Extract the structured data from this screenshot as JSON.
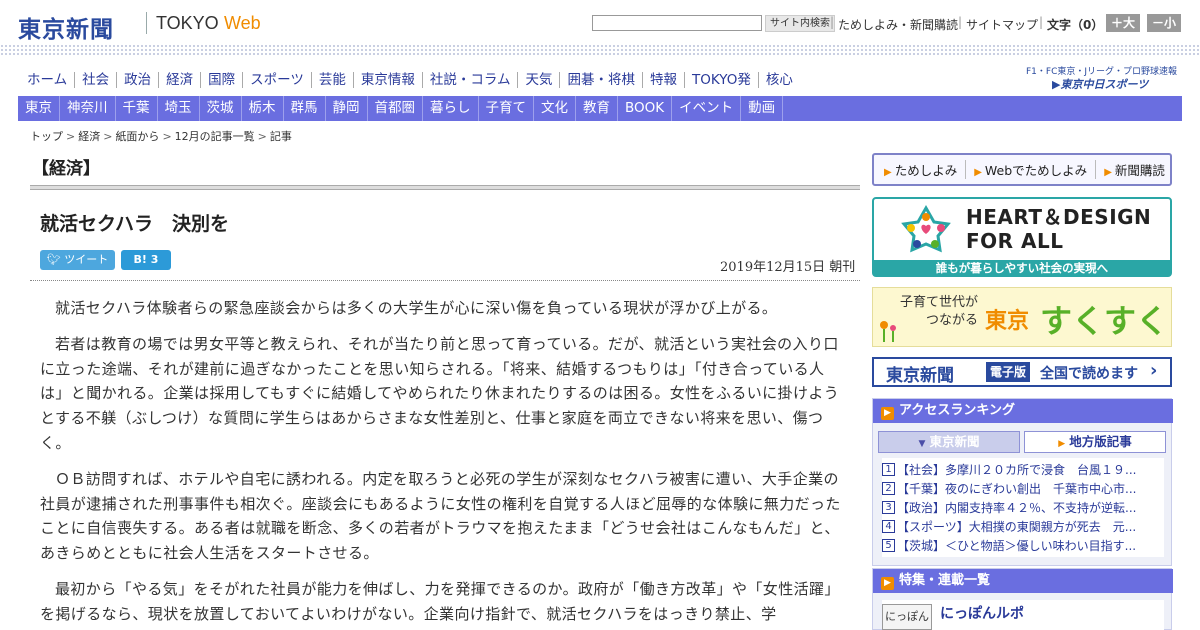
{
  "header": {
    "logo_cjk": "東京新聞",
    "logo_tokyo": "TOKYO",
    "logo_web": "Web",
    "search_button": "サイト内検索",
    "links": [
      "ためしよみ・新聞購読",
      "サイトマップ"
    ],
    "fontsize_label": "文字（0）",
    "font_bigger": "＋大",
    "font_smaller": "－小"
  },
  "main_nav": [
    "ホーム",
    "社会",
    "政治",
    "経済",
    "国際",
    "スポーツ",
    "芸能",
    "東京情報",
    "社説・コラム",
    "天気",
    "囲碁・将棋",
    "特報",
    "TOKYO発",
    "核心"
  ],
  "chunichi": {
    "top_text": "F1・FC東京・Jリーグ・プロ野球速報",
    "logo_text": "▶東京中日スポーツ"
  },
  "local_nav": [
    "東京",
    "神奈川",
    "千葉",
    "埼玉",
    "茨城",
    "栃木",
    "群馬",
    "静岡",
    "首都圏",
    "暮らし",
    "子育て",
    "文化",
    "教育",
    "BOOK",
    "イベント",
    "動画"
  ],
  "breadcrumb": [
    "トップ",
    "経済",
    "紙面から",
    "12月の記事一覧",
    "記事"
  ],
  "article": {
    "section": "【経済】",
    "headline": "就活セクハラ　決別を",
    "tweet_label": "ツイート",
    "hatena_label": "B! 3",
    "date": "2019年12月15日 朝刊",
    "paragraphs": [
      "就活セクハラ体験者らの緊急座談会からは多くの大学生が心に深い傷を負っている現状が浮かび上がる。",
      "若者は教育の場では男女平等と教えられ、それが当たり前と思って育っている。だが、就活という実社会の入り口に立った途端、それが建前に過ぎなかったことを思い知らされる。「将来、結婚するつもりは」「付き合っている人は」と聞かれる。企業は採用してもすぐに結婚してやめられたり休まれたりするのは困る。女性をふるいに掛けようとする不躾（ぶしつけ）な質問に学生らはあからさまな女性差別と、仕事と家庭を両立できない将来を思い、傷つく。",
      "ＯＢ訪問すれば、ホテルや自宅に誘われる。内定を取ろうと必死の学生が深刻なセクハラ被害に遭い、大手企業の社員が逮捕された刑事事件も相次ぐ。座談会にもあるように女性の権利を自覚する人ほど屈辱的な体験に無力だったことに自信喪失する。ある者は就職を断念、多くの若者がトラウマを抱えたまま「どうせ会社はこんなもんだ」と、あきらめとともに社会人生活をスタートさせる。",
      "最初から「やる気」をそがれた社員が能力を伸ばし、力を発揮できるのか。政府が「働き方改革」や「女性活躍」を掲げるなら、現状を放置しておいてよいわけがない。企業向け指針で、就活セクハラをはっきり禁止、学"
    ]
  },
  "sidebar": {
    "promo": [
      "ためしよみ",
      "Webでためしよみ",
      "新聞購読"
    ],
    "heart_title_1": "HEART＆DESIGN",
    "heart_title_2": "FOR ALL",
    "heart_sub": "誰もが暮らしやすい社会の実現へ",
    "sukusuku_small_1": "子育て世代が",
    "sukusuku_small_2": "つながる",
    "sukusuku_tokyo": "東京",
    "sukusuku_big": "すくすく",
    "denshi_logo": "東京新聞",
    "denshi_tag": "電子版",
    "denshi_text": "全国で読めます",
    "ranking_title": "アクセスランキング",
    "ranking_tabs": [
      "東京新聞",
      "地方版記事"
    ],
    "ranking": [
      {
        "num": "1",
        "text": "【社会】多摩川２０カ所で浸食　台風１９..."
      },
      {
        "num": "2",
        "text": "【千葉】夜のにぎわい創出　千葉市中心市..."
      },
      {
        "num": "3",
        "text": "【政治】内閣支持率４２％、不支持が逆転..."
      },
      {
        "num": "4",
        "text": "【スポーツ】大相撲の東関親方が死去　元..."
      },
      {
        "num": "5",
        "text": "【茨城】＜ひと物語＞優しい味わい目指す..."
      }
    ],
    "feature_title": "特集・連載一覧",
    "feature_thumb": "にっぽん",
    "feature_label": "にっぽんルポ"
  },
  "colors": {
    "brand_blue": "#2a4a9e",
    "nav_purple": "#6a6ee0",
    "accent_orange": "#f08c00",
    "teal": "#2aa6a6"
  }
}
